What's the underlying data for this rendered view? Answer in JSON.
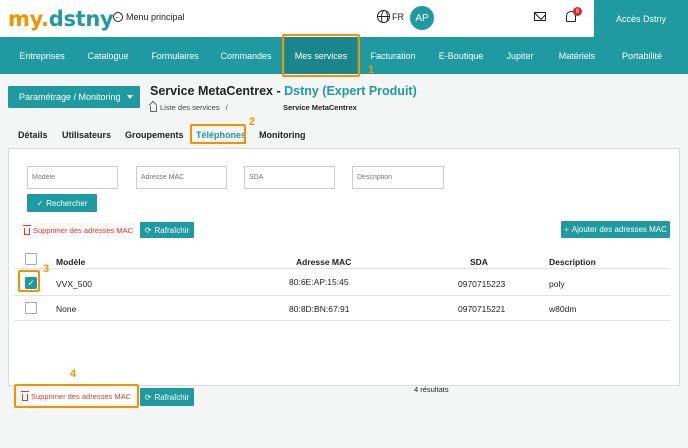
{
  "brand": {
    "my": "my.",
    "dstny": "dstny"
  },
  "header": {
    "menu_principal": "Menu principal",
    "lang": "FR",
    "avatar_initials": "AP",
    "notification_count": "6",
    "acces_label": "Accès Dstny"
  },
  "nav": {
    "items": [
      "Entreprises",
      "Catalogue",
      "Formulaires",
      "Commandes",
      "Mes services",
      "Facturation",
      "E-Boutique",
      "Jupiter",
      "Matériels",
      "Portabilité"
    ],
    "active": "Mes services"
  },
  "markers": [
    "1",
    "2",
    "3",
    "4"
  ],
  "page": {
    "param_button": "Paramétrage / Monitoring",
    "title_prefix": "Service MetaCentrex - ",
    "title_accent": "Dstny (Expert Produit)",
    "breadcrumb_home": "Liste des services",
    "breadcrumb_sep": "/",
    "breadcrumb_current": "Service MetaCentrex"
  },
  "tabs": [
    "Détails",
    "Utilisateurs",
    "Groupements",
    "Téléphones",
    "Monitoring"
  ],
  "filters": {
    "modele_placeholder": "Modèle",
    "mac_placeholder": "Adresse MAC",
    "sda_placeholder": "SDA",
    "description_placeholder": "Description",
    "search_button": "Rechercher"
  },
  "actions": {
    "delete_mac": "Supprimer des adresses MAC",
    "refresh": "Rafraîchir",
    "add_mac": "Ajouter des adresses MAC"
  },
  "table": {
    "headers": [
      "Modèle",
      "Adresse MAC",
      "SDA",
      "Description"
    ],
    "rows": [
      {
        "modele": "VVX_500",
        "mac": "80:6E:AP:15:45",
        "sda": "0970715223",
        "description": "poly",
        "checked": true
      },
      {
        "modele": "None",
        "mac": "80:8D:BN:67:91",
        "sda": "0970715221",
        "description": "w80dm",
        "checked": false
      }
    ]
  },
  "results_text": "4 résultats",
  "colors": {
    "teal": "#1f9aa1",
    "orange": "#f39200",
    "danger": "#d93a2b"
  }
}
